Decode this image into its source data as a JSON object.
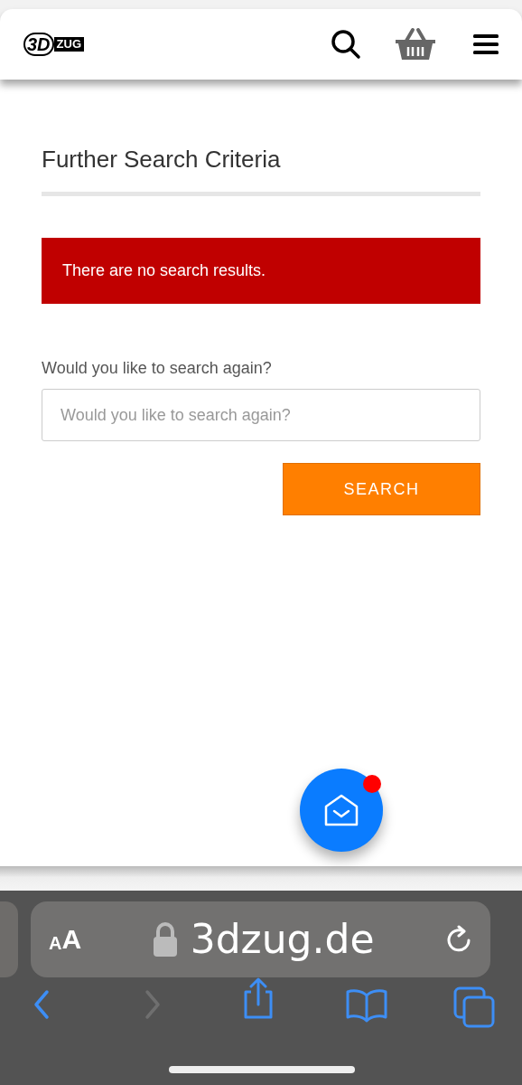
{
  "header": {
    "logo": {
      "part_1": "3D",
      "part_2": "ZUG"
    }
  },
  "page": {
    "title": "Further Search Criteria",
    "alert": "There are no search results.",
    "search_label": "Would you like to search again?",
    "search_field": {
      "placeholder": "Would you like to search again?"
    },
    "search_button": "SEARCH"
  },
  "chat_button": {
    "unread": true
  },
  "browser": {
    "text_size": {
      "small": "A",
      "large": "A"
    },
    "url": "3dzug.de",
    "toolbar": [
      {
        "kind": "back",
        "disabled": false
      },
      {
        "kind": "forward",
        "disabled": true
      },
      {
        "kind": "share",
        "disabled": false
      },
      {
        "kind": "bookmarks",
        "disabled": false
      },
      {
        "kind": "tabs",
        "disabled": false
      }
    ]
  }
}
